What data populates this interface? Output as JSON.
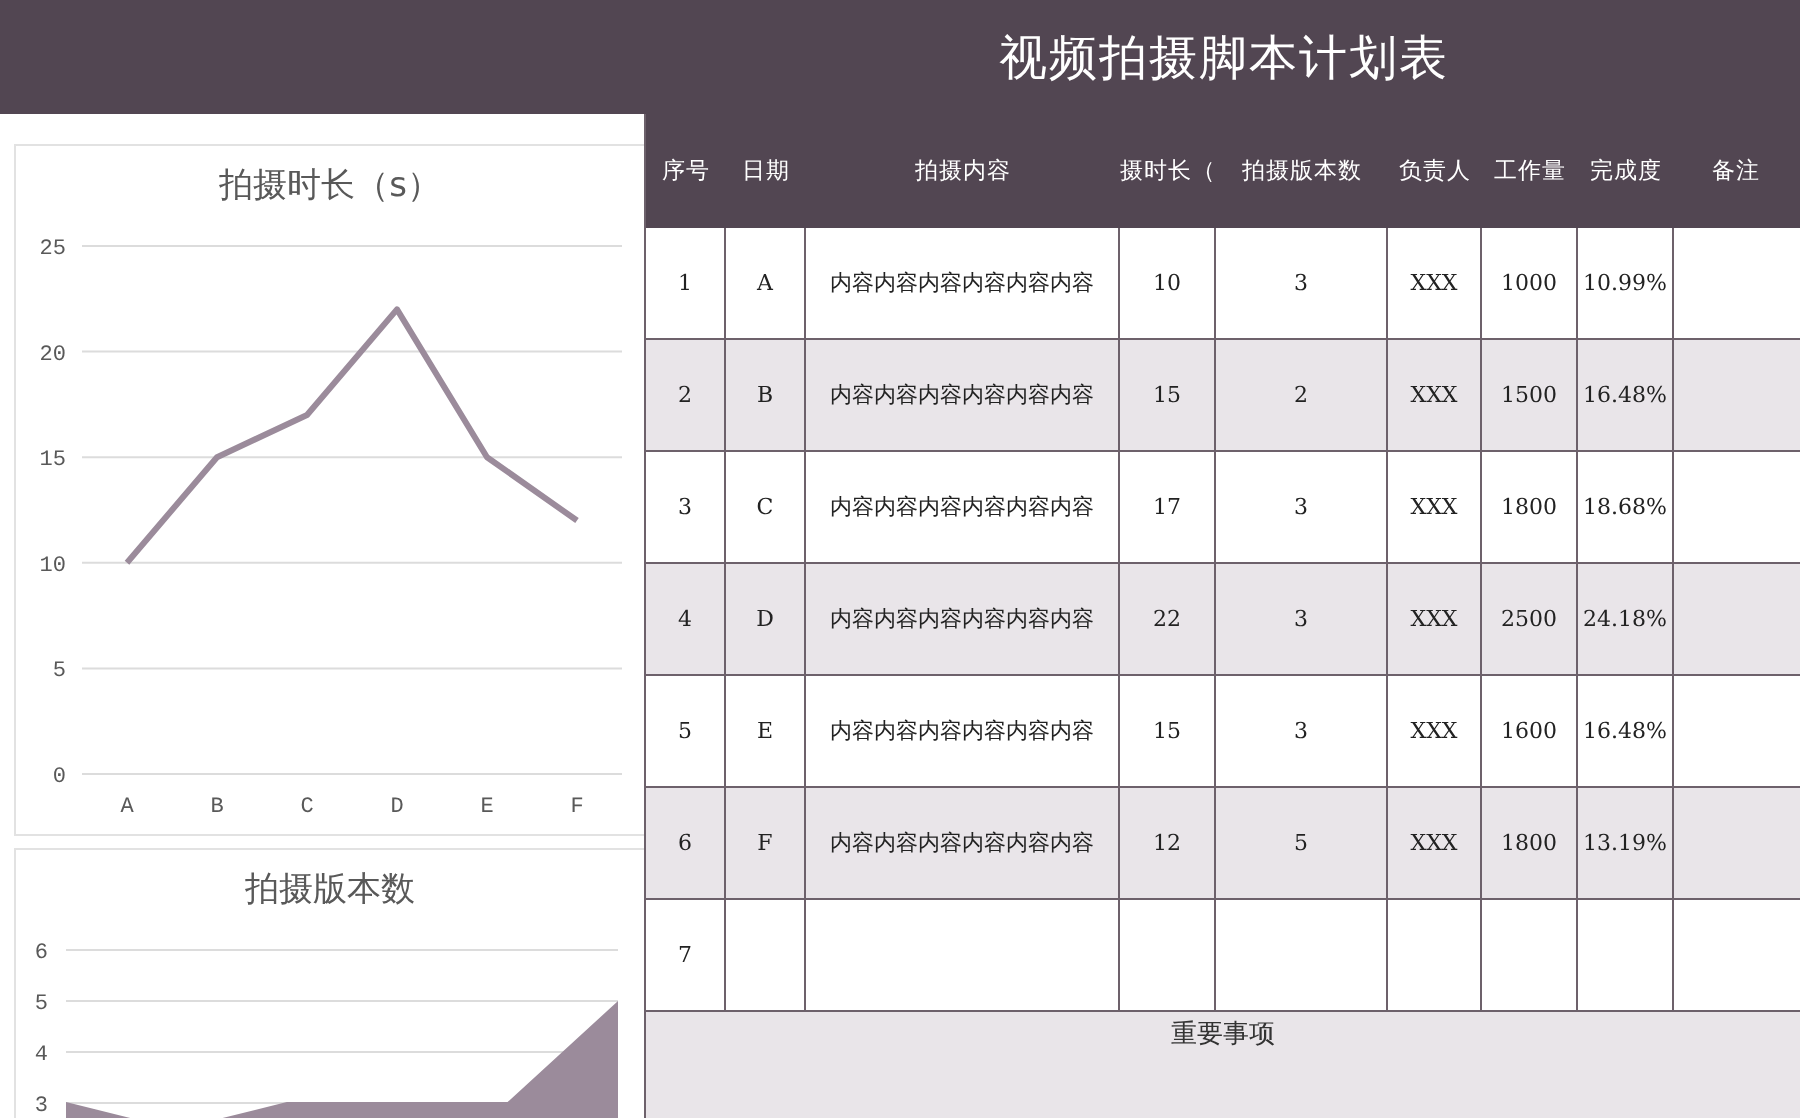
{
  "title": "视频拍摄脚本计划表",
  "charts": [
    {
      "title": "拍摄时长（s）",
      "chart_data": {
        "type": "line",
        "categories": [
          "A",
          "B",
          "C",
          "D",
          "E",
          "F"
        ],
        "series": [
          {
            "color": "#9b8b9b",
            "values": [
              10,
              15,
              17,
              22,
              15,
              12
            ]
          }
        ],
        "ylim": [
          0,
          25
        ],
        "yticks": [
          0,
          5,
          10,
          15,
          20,
          25
        ],
        "grid": true
      }
    },
    {
      "title": "拍摄版本数",
      "kind": "area_picture",
      "y_axis_labels": [
        "6",
        "5",
        "4",
        "3"
      ]
    }
  ],
  "table": {
    "columns": [
      "序号",
      "日期",
      "拍摄内容",
      "摄时长（",
      "拍摄版本数",
      "负责人",
      "工作量",
      "完成度",
      "备注"
    ],
    "rows": [
      {
        "cells": [
          "1",
          "A",
          "内容内容内容内容内容内容",
          "10",
          "3",
          "XXX",
          "1000",
          "10.99%"
        ]
      },
      {
        "cells": [
          "2",
          "B",
          "内容内容内容内容内容内容",
          "15",
          "2",
          "XXX",
          "1500",
          "16.48%"
        ]
      },
      {
        "cells": [
          "3",
          "C",
          "内容内容内容内容内容内容",
          "17",
          "3",
          "XXX",
          "1800",
          "18.68%"
        ]
      },
      {
        "cells": [
          "4",
          "D",
          "内容内容内容内容内容内容",
          "22",
          "3",
          "XXX",
          "2500",
          "24.18%"
        ]
      },
      {
        "cells": [
          "5",
          "E",
          "内容内容内容内容内容内容",
          "15",
          "3",
          "XXX",
          "1600",
          "16.48%"
        ]
      },
      {
        "cells": [
          "6",
          "F",
          "内容内容内容内容内容内容",
          "12",
          "5",
          "XXX",
          "1800",
          "13.19%"
        ]
      },
      {
        "cells": [
          "7"
        ]
      }
    ],
    "footer": "重要事项"
  }
}
